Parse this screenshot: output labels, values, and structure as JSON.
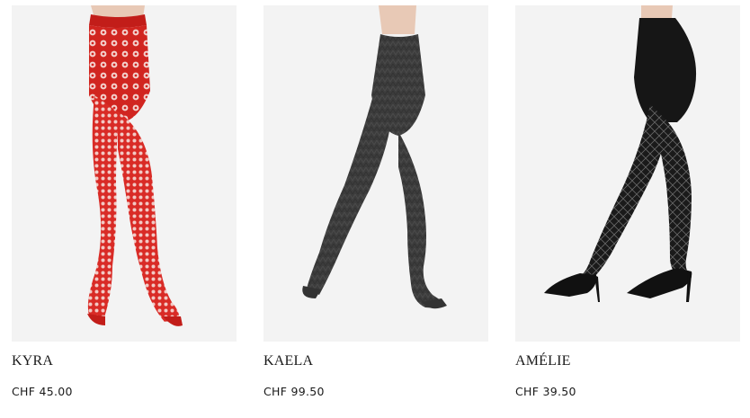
{
  "products": [
    {
      "name": "KYRA",
      "price": "CHF 45.00",
      "image_label": "red fishnet tights"
    },
    {
      "name": "KAELA",
      "price": "CHF 99.50",
      "image_label": "grey knit tights"
    },
    {
      "name": "AMÉLIE",
      "price": "CHF 39.50",
      "image_label": "black patterned tights"
    }
  ],
  "colors": {
    "background": "#ffffff",
    "photo_bg": "#f3f3f3",
    "kyra_red": "#d92b26",
    "kaela_grey": "#3c3c3c",
    "amelie_black": "#161616",
    "text": "#1a1a1a"
  }
}
